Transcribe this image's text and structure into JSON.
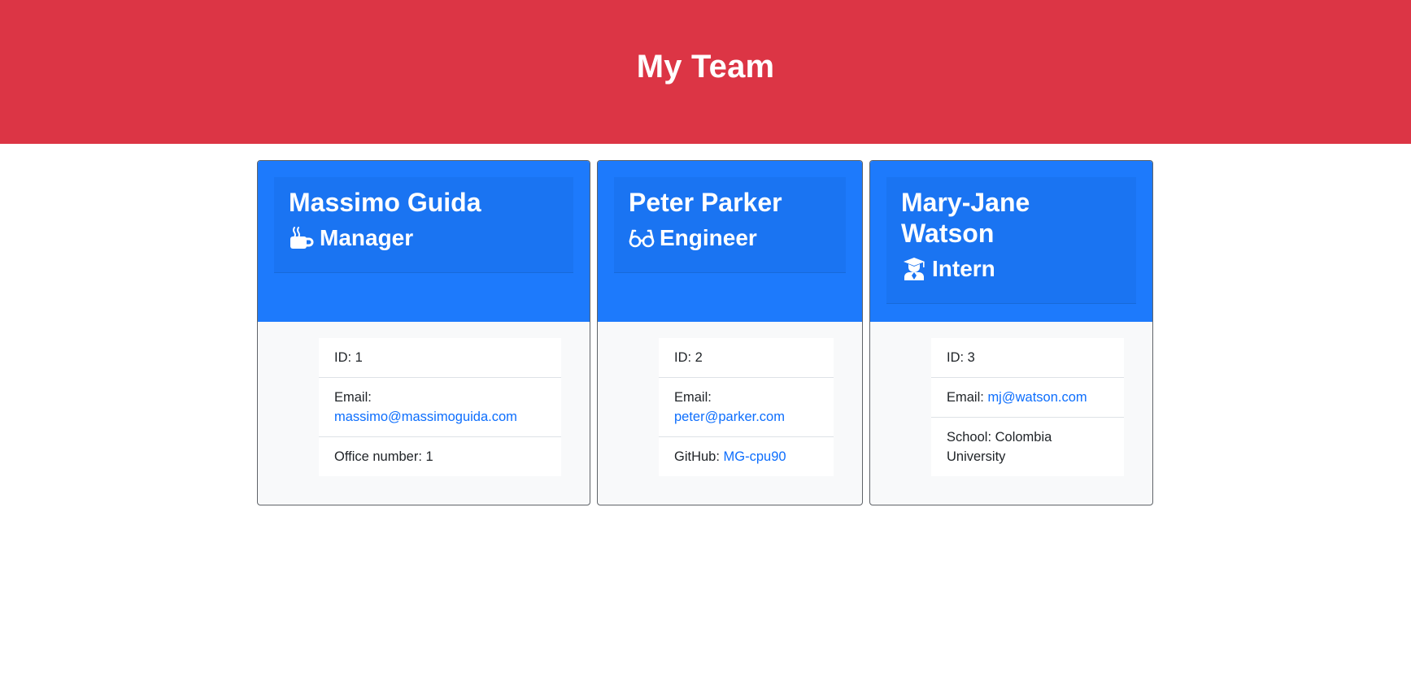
{
  "header": {
    "title": "My Team"
  },
  "colors": {
    "header_bg": "#dc3545",
    "card_top": "#1d7afc",
    "link": "#0d6efd"
  },
  "team": [
    {
      "name": "Massimo Guida",
      "role": "Manager",
      "role_icon": "coffee-mug-icon",
      "id_text": "ID: 1",
      "email_label": "Email:",
      "email": "massimo@massimoguida.com",
      "extra_label": "Office number: 1",
      "extra_value": ""
    },
    {
      "name": "Peter Parker",
      "role": "Engineer",
      "role_icon": "glasses-icon",
      "id_text": "ID: 2",
      "email_label": "Email:",
      "email": "peter@parker.com",
      "extra_label": "GitHub:",
      "extra_value": "MG-cpu90"
    },
    {
      "name": "Mary-Jane Watson",
      "role": "Intern",
      "role_icon": "graduate-icon",
      "id_text": "ID: 3",
      "email_label": "Email:",
      "email": "mj@watson.com",
      "extra_label": "School: Colombia University",
      "extra_value": ""
    }
  ]
}
